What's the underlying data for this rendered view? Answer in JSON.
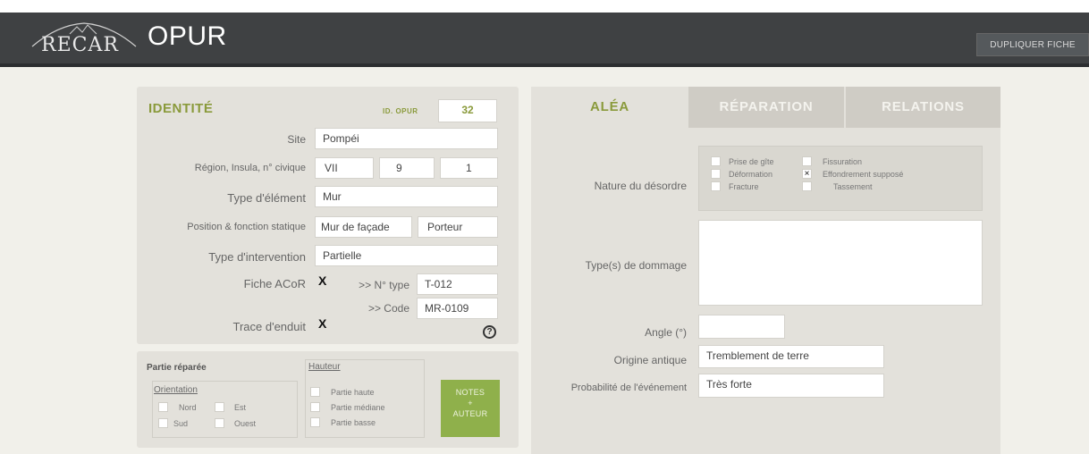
{
  "header": {
    "logo_text": "RECAR",
    "app_title": "OPUR",
    "duplicate_button": "DUPLIQUER FICHE"
  },
  "identite": {
    "title": "IDENTITÉ",
    "id_label": "ID. OPUR",
    "id_value": "32",
    "site_label": "Site",
    "site_value": "Pompéi",
    "region_label": "Région, Insula, n° civique",
    "region_values": [
      "VII",
      "9",
      "1"
    ],
    "type_element_label": "Type d'élément",
    "type_element_value": "Mur",
    "position_label": "Position & fonction statique",
    "position_value": "Mur de façade",
    "fonction_value": "Porteur",
    "intervention_label": "Type d'intervention",
    "intervention_value": "Partielle",
    "fiche_label": "Fiche ACoR",
    "fiche_checked": "X",
    "ntype_label": ">> N° type",
    "ntype_value": "T-012",
    "code_label": ">> Code",
    "code_value": "MR-0109",
    "trace_label": "Trace d'enduit",
    "trace_checked": "X",
    "help_icon": "?"
  },
  "partie_reparee": {
    "title": "Partie réparée",
    "orientation_label": "Orientation",
    "orientation_options": [
      "Nord",
      "Est",
      "Sud",
      "Ouest"
    ],
    "hauteur_label": "Hauteur",
    "hauteur_options": [
      "Partie haute",
      "Partie médiane",
      "Partie basse"
    ],
    "notes_button": [
      "NOTES",
      "+",
      "AUTEUR"
    ]
  },
  "tabs": [
    {
      "label": "ALÉA",
      "active": true
    },
    {
      "label": "RÉPARATION",
      "active": false
    },
    {
      "label": "RELATIONS",
      "active": false
    }
  ],
  "alea": {
    "nature_label": "Nature du désordre",
    "nature_options": [
      {
        "label": "Prise de gîte",
        "checked": false
      },
      {
        "label": "Fissuration",
        "checked": false
      },
      {
        "label": "Déformation",
        "checked": false
      },
      {
        "label": "Effondrement supposé",
        "checked": true,
        "mark": "×"
      },
      {
        "label": "Fracture",
        "checked": false
      },
      {
        "label": "Tassement",
        "checked": false
      }
    ],
    "dommage_label": "Type(s) de dommage",
    "angle_label": "Angle (°)",
    "angle_value": "",
    "origine_label": "Origine antique",
    "origine_value": "Tremblement de terre",
    "probabilite_label": "Probabilité de l'événement",
    "probabilite_value": "Très forte"
  },
  "colors": {
    "header_bg": "#3f4143",
    "accent_green": "#8a9a3b",
    "panel_bg": "#e3e1db",
    "canvas_bg": "#f1f0ea",
    "button_green": "#8fb04b"
  }
}
